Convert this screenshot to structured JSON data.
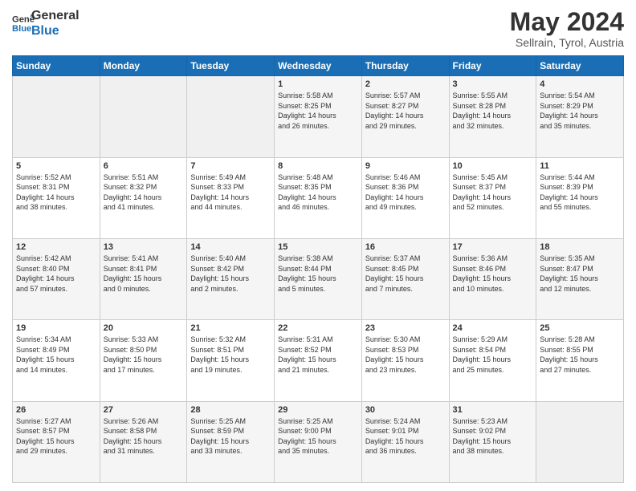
{
  "logo": {
    "line1": "General",
    "line2": "Blue"
  },
  "header": {
    "month": "May 2024",
    "location": "Sellrain, Tyrol, Austria"
  },
  "days_of_week": [
    "Sunday",
    "Monday",
    "Tuesday",
    "Wednesday",
    "Thursday",
    "Friday",
    "Saturday"
  ],
  "weeks": [
    [
      {
        "day": "",
        "info": ""
      },
      {
        "day": "",
        "info": ""
      },
      {
        "day": "",
        "info": ""
      },
      {
        "day": "1",
        "info": "Sunrise: 5:58 AM\nSunset: 8:25 PM\nDaylight: 14 hours\nand 26 minutes."
      },
      {
        "day": "2",
        "info": "Sunrise: 5:57 AM\nSunset: 8:27 PM\nDaylight: 14 hours\nand 29 minutes."
      },
      {
        "day": "3",
        "info": "Sunrise: 5:55 AM\nSunset: 8:28 PM\nDaylight: 14 hours\nand 32 minutes."
      },
      {
        "day": "4",
        "info": "Sunrise: 5:54 AM\nSunset: 8:29 PM\nDaylight: 14 hours\nand 35 minutes."
      }
    ],
    [
      {
        "day": "5",
        "info": "Sunrise: 5:52 AM\nSunset: 8:31 PM\nDaylight: 14 hours\nand 38 minutes."
      },
      {
        "day": "6",
        "info": "Sunrise: 5:51 AM\nSunset: 8:32 PM\nDaylight: 14 hours\nand 41 minutes."
      },
      {
        "day": "7",
        "info": "Sunrise: 5:49 AM\nSunset: 8:33 PM\nDaylight: 14 hours\nand 44 minutes."
      },
      {
        "day": "8",
        "info": "Sunrise: 5:48 AM\nSunset: 8:35 PM\nDaylight: 14 hours\nand 46 minutes."
      },
      {
        "day": "9",
        "info": "Sunrise: 5:46 AM\nSunset: 8:36 PM\nDaylight: 14 hours\nand 49 minutes."
      },
      {
        "day": "10",
        "info": "Sunrise: 5:45 AM\nSunset: 8:37 PM\nDaylight: 14 hours\nand 52 minutes."
      },
      {
        "day": "11",
        "info": "Sunrise: 5:44 AM\nSunset: 8:39 PM\nDaylight: 14 hours\nand 55 minutes."
      }
    ],
    [
      {
        "day": "12",
        "info": "Sunrise: 5:42 AM\nSunset: 8:40 PM\nDaylight: 14 hours\nand 57 minutes."
      },
      {
        "day": "13",
        "info": "Sunrise: 5:41 AM\nSunset: 8:41 PM\nDaylight: 15 hours\nand 0 minutes."
      },
      {
        "day": "14",
        "info": "Sunrise: 5:40 AM\nSunset: 8:42 PM\nDaylight: 15 hours\nand 2 minutes."
      },
      {
        "day": "15",
        "info": "Sunrise: 5:38 AM\nSunset: 8:44 PM\nDaylight: 15 hours\nand 5 minutes."
      },
      {
        "day": "16",
        "info": "Sunrise: 5:37 AM\nSunset: 8:45 PM\nDaylight: 15 hours\nand 7 minutes."
      },
      {
        "day": "17",
        "info": "Sunrise: 5:36 AM\nSunset: 8:46 PM\nDaylight: 15 hours\nand 10 minutes."
      },
      {
        "day": "18",
        "info": "Sunrise: 5:35 AM\nSunset: 8:47 PM\nDaylight: 15 hours\nand 12 minutes."
      }
    ],
    [
      {
        "day": "19",
        "info": "Sunrise: 5:34 AM\nSunset: 8:49 PM\nDaylight: 15 hours\nand 14 minutes."
      },
      {
        "day": "20",
        "info": "Sunrise: 5:33 AM\nSunset: 8:50 PM\nDaylight: 15 hours\nand 17 minutes."
      },
      {
        "day": "21",
        "info": "Sunrise: 5:32 AM\nSunset: 8:51 PM\nDaylight: 15 hours\nand 19 minutes."
      },
      {
        "day": "22",
        "info": "Sunrise: 5:31 AM\nSunset: 8:52 PM\nDaylight: 15 hours\nand 21 minutes."
      },
      {
        "day": "23",
        "info": "Sunrise: 5:30 AM\nSunset: 8:53 PM\nDaylight: 15 hours\nand 23 minutes."
      },
      {
        "day": "24",
        "info": "Sunrise: 5:29 AM\nSunset: 8:54 PM\nDaylight: 15 hours\nand 25 minutes."
      },
      {
        "day": "25",
        "info": "Sunrise: 5:28 AM\nSunset: 8:55 PM\nDaylight: 15 hours\nand 27 minutes."
      }
    ],
    [
      {
        "day": "26",
        "info": "Sunrise: 5:27 AM\nSunset: 8:57 PM\nDaylight: 15 hours\nand 29 minutes."
      },
      {
        "day": "27",
        "info": "Sunrise: 5:26 AM\nSunset: 8:58 PM\nDaylight: 15 hours\nand 31 minutes."
      },
      {
        "day": "28",
        "info": "Sunrise: 5:25 AM\nSunset: 8:59 PM\nDaylight: 15 hours\nand 33 minutes."
      },
      {
        "day": "29",
        "info": "Sunrise: 5:25 AM\nSunset: 9:00 PM\nDaylight: 15 hours\nand 35 minutes."
      },
      {
        "day": "30",
        "info": "Sunrise: 5:24 AM\nSunset: 9:01 PM\nDaylight: 15 hours\nand 36 minutes."
      },
      {
        "day": "31",
        "info": "Sunrise: 5:23 AM\nSunset: 9:02 PM\nDaylight: 15 hours\nand 38 minutes."
      },
      {
        "day": "",
        "info": ""
      }
    ]
  ]
}
